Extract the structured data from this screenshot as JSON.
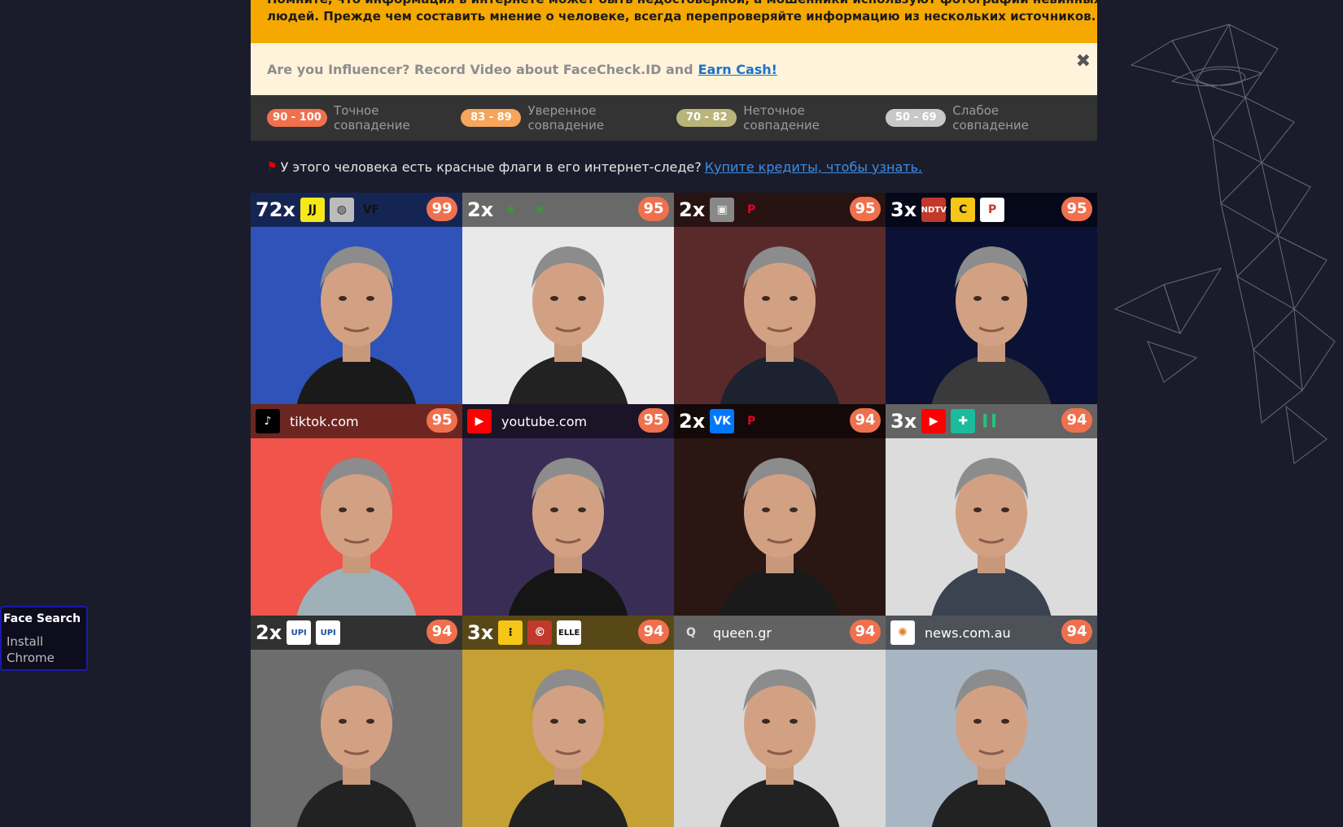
{
  "warning": {
    "line1": "Помните, что информация в интернете может быть недостоверной, а мошенники используют фотографии невинных",
    "line2": "людей. Прежде чем составить мнение о человеке, всегда перепроверяйте информацию из нескольких источников."
  },
  "influencer": {
    "text": "Are you Influencer? Record Video about FaceCheck.ID and",
    "link": "Earn Cash!",
    "close": "✖"
  },
  "legend": [
    {
      "range": "90 - 100",
      "label": "Точное совпадение",
      "color": "#f0704e"
    },
    {
      "range": "83 - 89",
      "label": "Уверенное совпадение",
      "color": "#f5a55c"
    },
    {
      "range": "70 - 82",
      "label": "Неточное совпадение",
      "color": "#b9b57a"
    },
    {
      "range": "50 - 69",
      "label": "Слабое совпадение",
      "color": "#c8c8c8"
    }
  ],
  "flag_notice": {
    "text": "У этого человека есть красные флаги в его интернет-следе?",
    "link": "Купите кредиты, чтобы узнать."
  },
  "results": [
    {
      "count": "72x",
      "site": "",
      "score": "99",
      "icons": [
        "jj-icon",
        "globe-icon",
        "vf-icon"
      ],
      "bg": "#2f53b8",
      "shirt": "#1a1a1a"
    },
    {
      "count": "2x",
      "site": "",
      "score": "95",
      "icons": [
        "lotus-icon",
        "lotus-icon"
      ],
      "bg": "#e9e9e9",
      "shirt": "#222"
    },
    {
      "count": "2x",
      "site": "",
      "score": "95",
      "icons": [
        "photo-icon",
        "pinterest-icon"
      ],
      "bg": "#5a2a2a",
      "shirt": "#1c2230"
    },
    {
      "count": "3x",
      "site": "",
      "score": "95",
      "icons": [
        "ndtv-icon",
        "c-icon",
        "p-icon"
      ],
      "bg": "#0b1236",
      "shirt": "#3a3a3a"
    },
    {
      "count": "",
      "site": "tiktok.com",
      "score": "95",
      "icons": [
        "tiktok-icon"
      ],
      "bg": "#f0544a",
      "shirt": "#9fb0b8"
    },
    {
      "count": "",
      "site": "youtube.com",
      "score": "95",
      "icons": [
        "youtube-icon"
      ],
      "bg": "#3a2d55",
      "shirt": "#151515"
    },
    {
      "count": "2x",
      "site": "",
      "score": "94",
      "icons": [
        "vk-icon",
        "pinterest-icon"
      ],
      "bg": "#2a1612",
      "shirt": "#1a1a1a"
    },
    {
      "count": "3x",
      "site": "",
      "score": "94",
      "icons": [
        "youtube-icon",
        "plus-icon",
        "green-icon"
      ],
      "bg": "#dcdcdc",
      "shirt": "#3b4250"
    },
    {
      "count": "2x",
      "site": "",
      "score": "94",
      "icons": [
        "upi-icon",
        "upi-icon"
      ],
      "bg": "#6d6d6d",
      "shirt": "#222"
    },
    {
      "count": "3x",
      "site": "",
      "score": "94",
      "icons": [
        "dots-icon",
        "copyright-icon",
        "elle-icon"
      ],
      "bg": "#c5a034",
      "shirt": "#222"
    },
    {
      "count": "",
      "site": "queen.gr",
      "score": "94",
      "icons": [
        "queen-icon"
      ],
      "bg": "#d9d9d9",
      "shirt": "#222"
    },
    {
      "count": "",
      "site": "news.com.au",
      "score": "94",
      "icons": [
        "newscomau-icon"
      ],
      "bg": "#a8b6c4",
      "shirt": "#222"
    }
  ],
  "icon_text": {
    "jj-icon": "JJ",
    "globe-icon": "◍",
    "vf-icon": "VF",
    "lotus-icon": "❀",
    "photo-icon": "▣",
    "pinterest-icon": "P",
    "ndtv-icon": "NDTV",
    "c-icon": "C",
    "p-icon": "P",
    "tiktok-icon": "♪",
    "youtube-icon": "▶",
    "vk-icon": "VK",
    "plus-icon": "✚",
    "green-icon": "▍▍",
    "upi-icon": "UPI",
    "dots-icon": "⁝",
    "copyright-icon": "©",
    "elle-icon": "ELLE",
    "queen-icon": "Q",
    "newscomau-icon": "✺"
  },
  "side_panel": {
    "title": "Face Search",
    "install1": "Install",
    "install2": "Chrome"
  }
}
